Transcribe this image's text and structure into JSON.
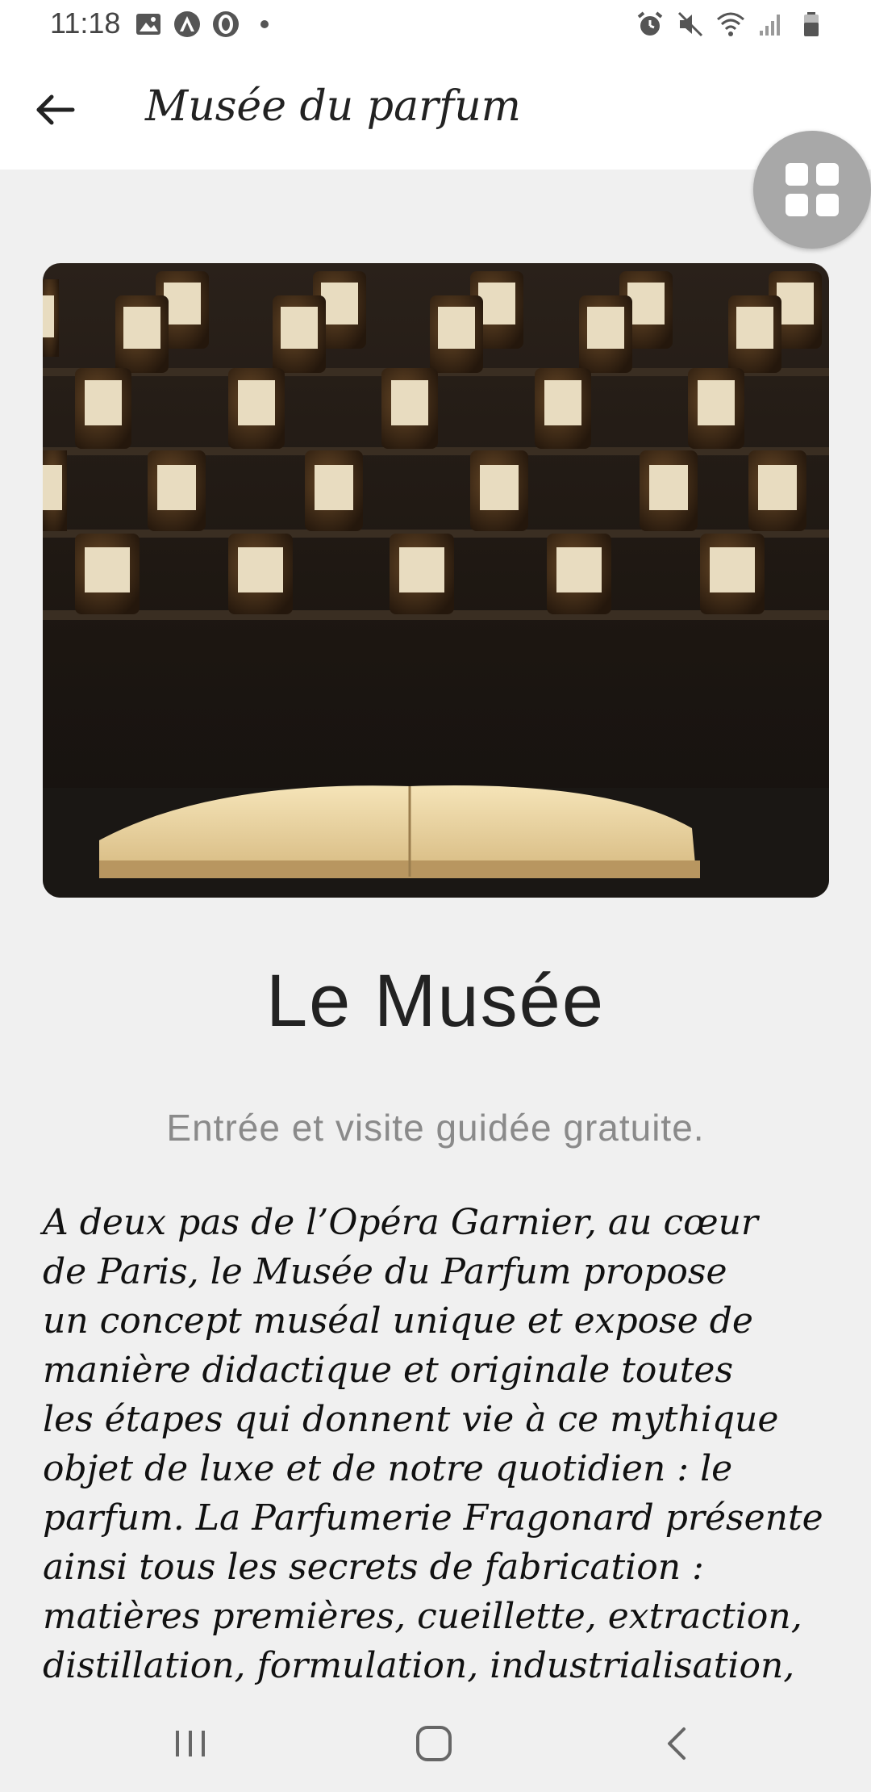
{
  "status_bar": {
    "time": "11:18",
    "left_icons": [
      "gallery-icon",
      "app-a-icon",
      "app-o-icon",
      "dot-icon"
    ],
    "right_icons": [
      "alarm-icon",
      "mute-icon",
      "wifi-icon",
      "signal-icon",
      "battery-icon"
    ]
  },
  "appbar": {
    "title": "Musée du parfum",
    "back_icon": "arrow-left-icon"
  },
  "fab": {
    "icon": "grid-icon"
  },
  "hero_image": {
    "description_icon": "perfume-bottles-book-photo"
  },
  "content": {
    "heading": "Le Musée",
    "subheading": "Entrée et visite guidée gratuite.",
    "body_lines": [
      "A deux pas de l’Opéra Garnier, au cœur",
      "de Paris, le Musée du Parfum propose",
      "un concept muséal unique et expose de",
      "manière didactique et originale toutes",
      "les étapes qui donnent vie à ce mythique",
      "objet de luxe et de notre quotidien : le",
      "parfum. La Parfumerie Fragonard présente",
      "ainsi tous les secrets de fabrication :",
      "matières premières, cueillette, extraction,",
      "distillation, formulation, industrialisation,"
    ]
  },
  "navbar": {
    "icons": [
      "recent-apps-icon",
      "home-icon",
      "back-icon"
    ]
  },
  "colors": {
    "background": "#f0f0f0",
    "appbar": "#ffffff",
    "fab": "#a8a8a8",
    "subheading": "#8a8a8a"
  }
}
